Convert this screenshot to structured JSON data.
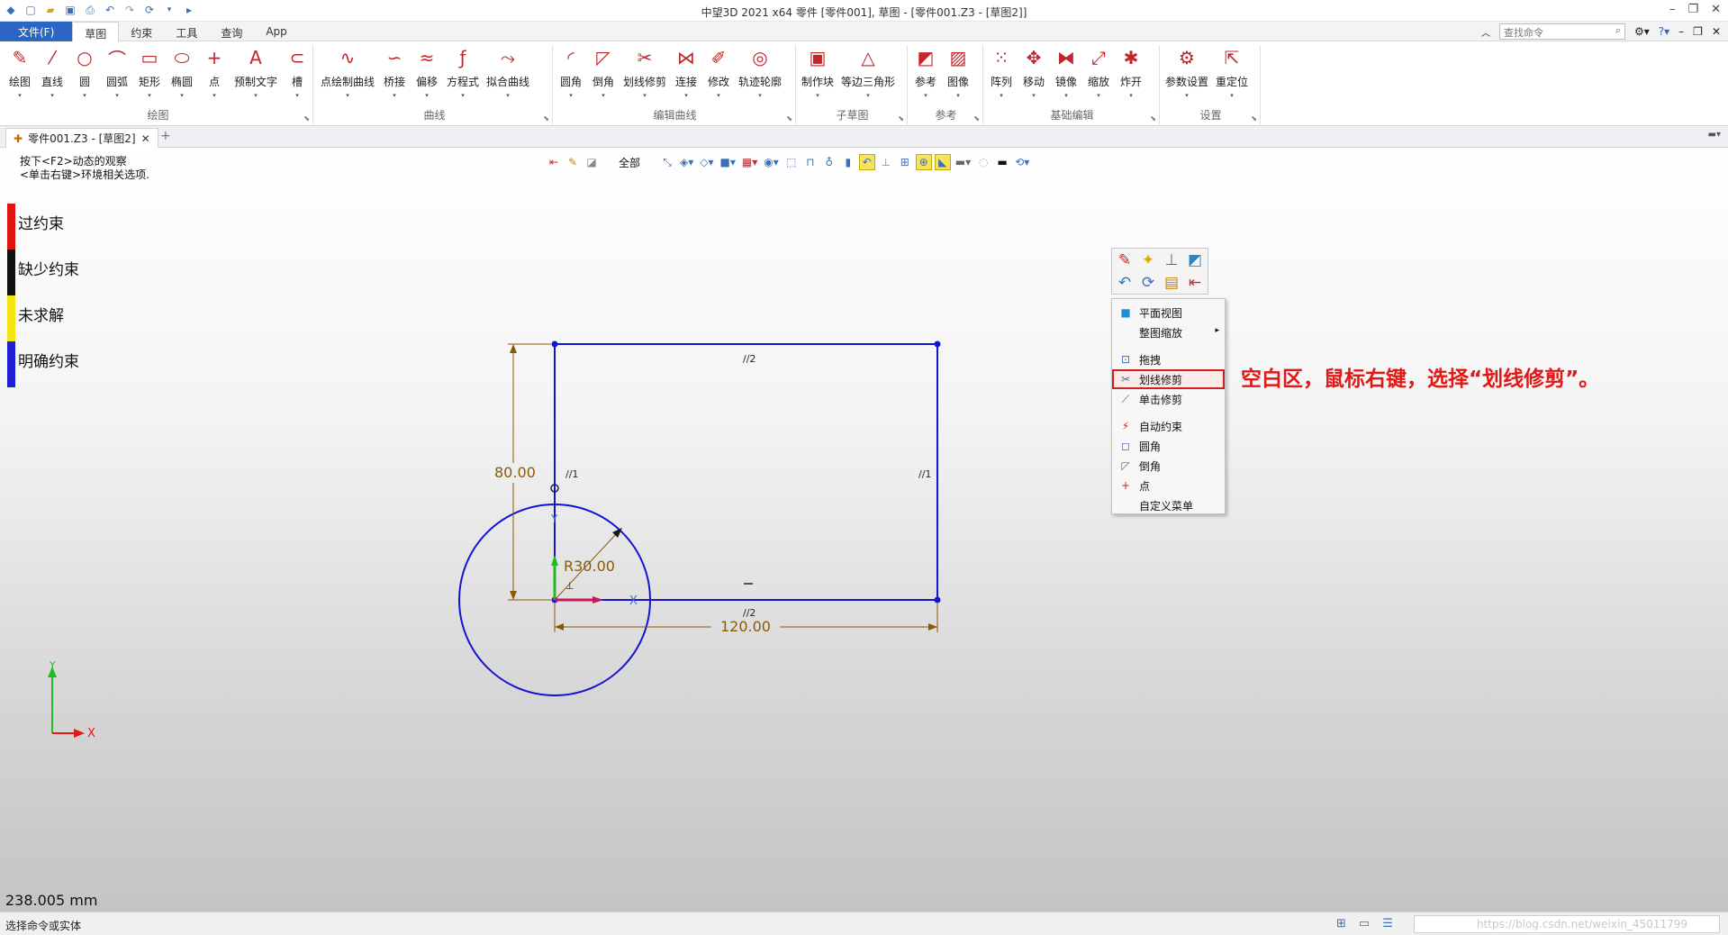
{
  "window": {
    "title": "中望3D 2021 x64        零件 [零件001], 草图 - [零件001.Z3 - [草图2]]",
    "controls": [
      "–",
      "❐",
      "✕"
    ]
  },
  "menu": {
    "file": "文件(F)",
    "tabs": [
      "草图",
      "约束",
      "工具",
      "查询",
      "App"
    ],
    "search_placeholder": "查找命令"
  },
  "ribbon": {
    "groups": [
      {
        "name": "绘图",
        "tools": [
          {
            "label": "绘图",
            "icon": "pencil-icon",
            "glyph": "✎"
          },
          {
            "label": "直线",
            "icon": "line-icon",
            "glyph": "⁄"
          },
          {
            "label": "圆",
            "icon": "circle-icon",
            "glyph": "○"
          },
          {
            "label": "圆弧",
            "icon": "arc-icon",
            "glyph": "⌒"
          },
          {
            "label": "矩形",
            "icon": "rectangle-icon",
            "glyph": "▭"
          },
          {
            "label": "椭圆",
            "icon": "ellipse-icon",
            "glyph": "⬭"
          },
          {
            "label": "点",
            "icon": "point-icon",
            "glyph": "+"
          },
          {
            "label": "预制文字",
            "icon": "text-icon",
            "glyph": "A"
          },
          {
            "label": "槽",
            "icon": "slot-icon",
            "glyph": "⊂"
          }
        ]
      },
      {
        "name": "曲线",
        "tools": [
          {
            "label": "点绘制曲线",
            "icon": "spline-icon",
            "glyph": "∿"
          },
          {
            "label": "桥接",
            "icon": "bridge-icon",
            "glyph": "∽"
          },
          {
            "label": "偏移",
            "icon": "offset-icon",
            "glyph": "≈"
          },
          {
            "label": "方程式",
            "icon": "equation-icon",
            "glyph": "ƒ"
          },
          {
            "label": "拟合曲线",
            "icon": "fit-curve-icon",
            "glyph": "⤳"
          }
        ]
      },
      {
        "name": "编辑曲线",
        "tools": [
          {
            "label": "圆角",
            "icon": "fillet-icon",
            "glyph": "◜"
          },
          {
            "label": "倒角",
            "icon": "chamfer-icon",
            "glyph": "◸"
          },
          {
            "label": "划线修剪",
            "icon": "trim-icon",
            "glyph": "✂"
          },
          {
            "label": "连接",
            "icon": "join-icon",
            "glyph": "⋈"
          },
          {
            "label": "修改",
            "icon": "modify-icon",
            "glyph": "✐"
          },
          {
            "label": "轨迹轮廓",
            "icon": "trace-profile-icon",
            "glyph": "◎"
          }
        ]
      },
      {
        "name": "子草图",
        "tools": [
          {
            "label": "制作块",
            "icon": "make-block-icon",
            "glyph": "▣"
          },
          {
            "label": "等边三角形",
            "icon": "triangle-icon",
            "glyph": "△"
          }
        ]
      },
      {
        "name": "参考",
        "tools": [
          {
            "label": "参考",
            "icon": "reference-icon",
            "glyph": "◩"
          },
          {
            "label": "图像",
            "icon": "image-icon",
            "glyph": "▨"
          }
        ]
      },
      {
        "name": "基础编辑",
        "tools": [
          {
            "label": "阵列",
            "icon": "pattern-icon",
            "glyph": "⁙"
          },
          {
            "label": "移动",
            "icon": "move-icon",
            "glyph": "✥"
          },
          {
            "label": "镜像",
            "icon": "mirror-icon",
            "glyph": "⧓"
          },
          {
            "label": "缩放",
            "icon": "scale-icon",
            "glyph": "⤢"
          },
          {
            "label": "炸开",
            "icon": "explode-icon",
            "glyph": "✱"
          }
        ]
      },
      {
        "name": "设置",
        "tools": [
          {
            "label": "参数设置",
            "icon": "settings-icon",
            "glyph": "⚙"
          },
          {
            "label": "重定位",
            "icon": "relocate-icon",
            "glyph": "⇱"
          }
        ]
      }
    ]
  },
  "document_tab": {
    "title": "零件001.Z3 - [草图2]",
    "close": "✕",
    "add": "+"
  },
  "hint": {
    "line1": "按下<F2>动态的观察",
    "line2": "<单击右键>环境相关选项."
  },
  "view_toolbar": {
    "filter": "全部"
  },
  "status_legend": [
    {
      "label": "过约束",
      "color": "#e11414"
    },
    {
      "label": "缺少约束",
      "color": "#111111"
    },
    {
      "label": "未求解",
      "color": "#f2e60c"
    },
    {
      "label": "明确约束",
      "color": "#1f1fd6"
    }
  ],
  "sketch": {
    "line_color": "#1414d2",
    "dimension_color": "#8a5a00",
    "dimensions": {
      "height": "80.00",
      "width": "120.00",
      "radius": "R30.00"
    },
    "constraint_labels": {
      "top": "//2",
      "bottom": "//2",
      "left": "//1",
      "right": "//1"
    },
    "axis": {
      "x": "X",
      "y": "Y"
    }
  },
  "context_menu": {
    "items": [
      {
        "label": "平面视图",
        "icon": "plane-view-icon",
        "glyph": "■"
      },
      {
        "label": "整图缩放",
        "icon": "zoom-all-icon",
        "glyph": "",
        "submenu": "▸"
      },
      {
        "label": "拖拽",
        "icon": "drag-icon",
        "glyph": "⊡"
      },
      {
        "label": "划线修剪",
        "icon": "trim-icon",
        "glyph": "✂",
        "highlighted": true
      },
      {
        "label": "单击修剪",
        "icon": "single-trim-icon",
        "glyph": "⟋"
      },
      {
        "label": "自动约束",
        "icon": "auto-constrain-icon",
        "glyph": "⚡"
      },
      {
        "label": "圆角",
        "icon": "fillet-icon",
        "glyph": "◻"
      },
      {
        "label": "倒角",
        "icon": "chamfer-icon",
        "glyph": "◸"
      },
      {
        "label": "点",
        "icon": "point-icon",
        "glyph": "+"
      },
      {
        "label": "自定义菜单",
        "icon": "",
        "glyph": ""
      }
    ]
  },
  "annotation": "空白区，鼠标右键，选择“划线修剪”。",
  "measurement": "238.005 mm",
  "status_bar": {
    "message": "选择命令或实体",
    "watermark": "https://blog.csdn.net/weixin_45011799"
  }
}
